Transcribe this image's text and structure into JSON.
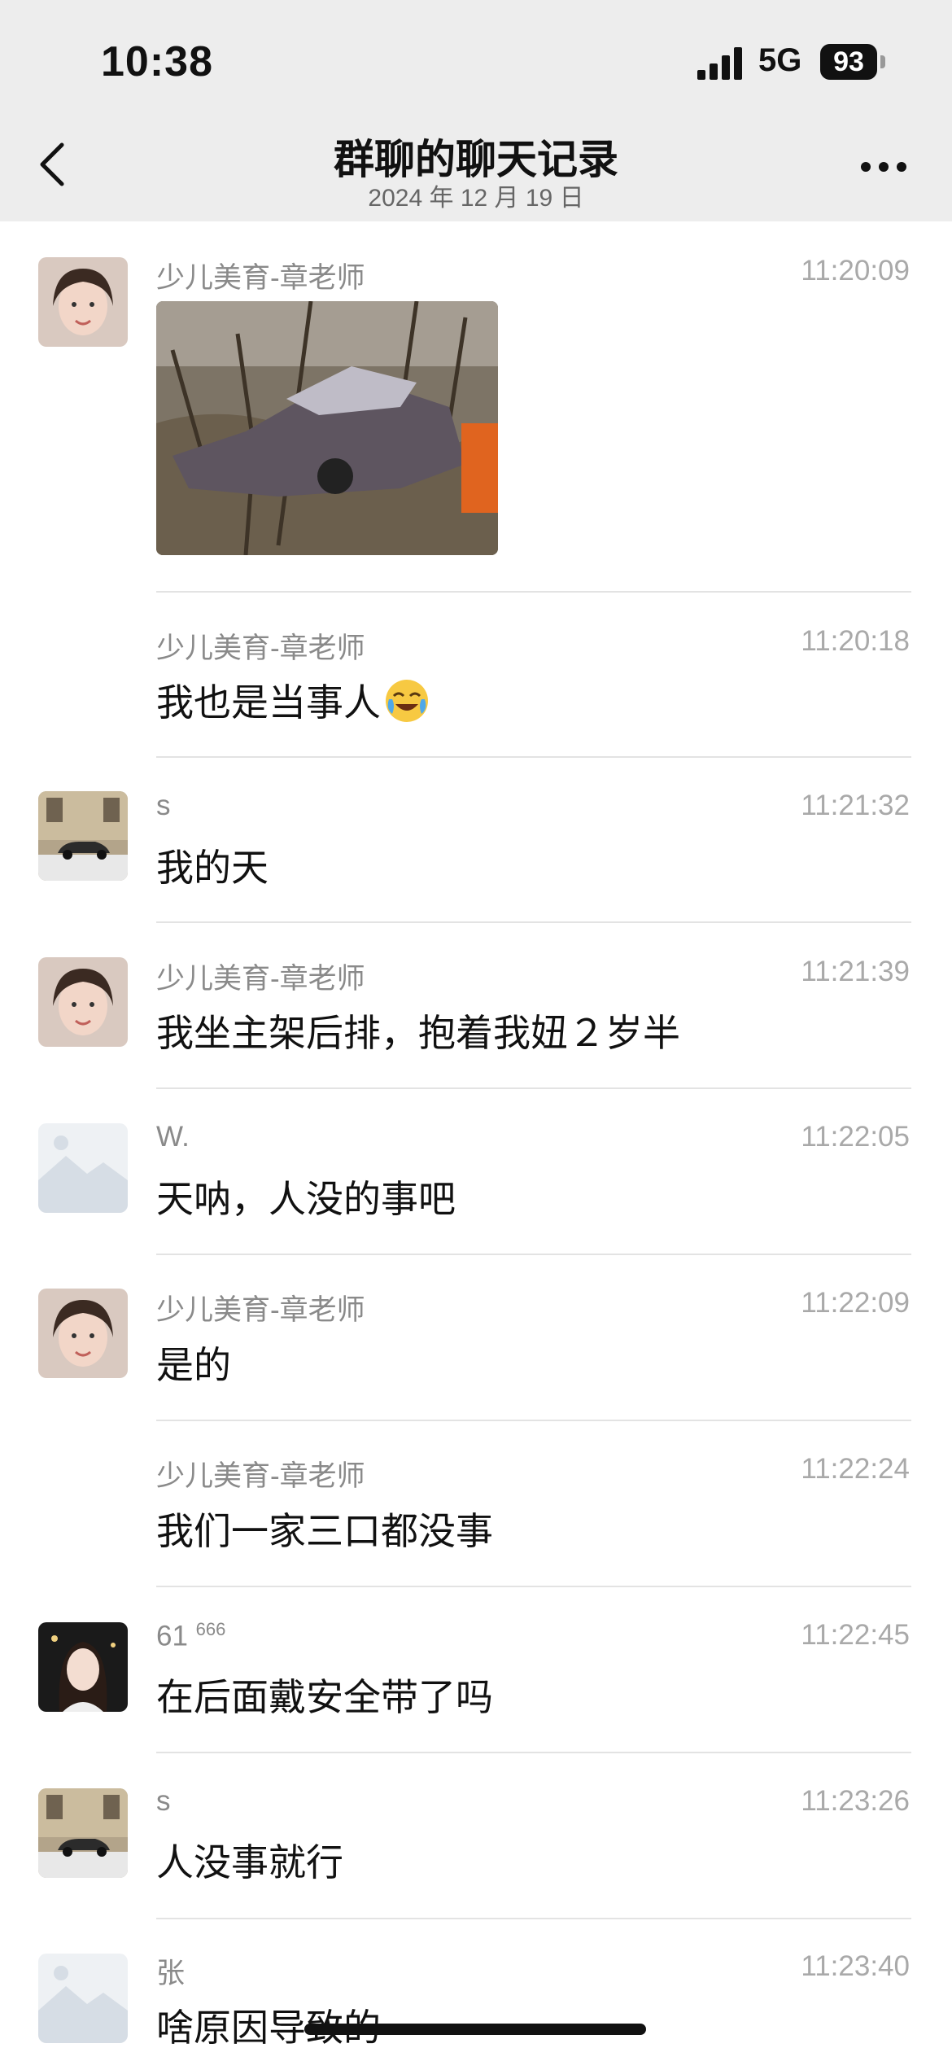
{
  "status_bar": {
    "time": "10:38",
    "network": "5G",
    "battery": "93"
  },
  "nav": {
    "title": "群聊的聊天记录",
    "date": "2024 年 12 月 19 日"
  },
  "messages": [
    {
      "sender": "少儿美育-章老师",
      "time": "11:20:09",
      "text": ""
    },
    {
      "sender": "少儿美育-章老师",
      "time": "11:20:18",
      "text": "我也是当事人"
    },
    {
      "sender": "s",
      "time": "11:21:32",
      "text": "我的天"
    },
    {
      "sender": "少儿美育-章老师",
      "time": "11:21:39",
      "text": "我坐主架后排，抱着我妞２岁半"
    },
    {
      "sender": "W.",
      "time": "11:22:05",
      "text": "天呐，人没的事吧"
    },
    {
      "sender": "少儿美育-章老师",
      "time": "11:22:09",
      "text": "是的"
    },
    {
      "sender": "少儿美育-章老师",
      "time": "11:22:24",
      "text": "我们一家三口都没事"
    },
    {
      "sender": "61",
      "sender_suffix": "666",
      "time": "11:22:45",
      "text": "在后面戴安全带了吗"
    },
    {
      "sender": "s",
      "time": "11:23:26",
      "text": "人没事就行"
    },
    {
      "sender": "张",
      "time": "11:23:40",
      "text": "啥原因导致的"
    }
  ],
  "icons": {
    "back": "chevron-left-icon",
    "more": "more-dots-icon",
    "emoji": "crying-laugh-emoji"
  }
}
